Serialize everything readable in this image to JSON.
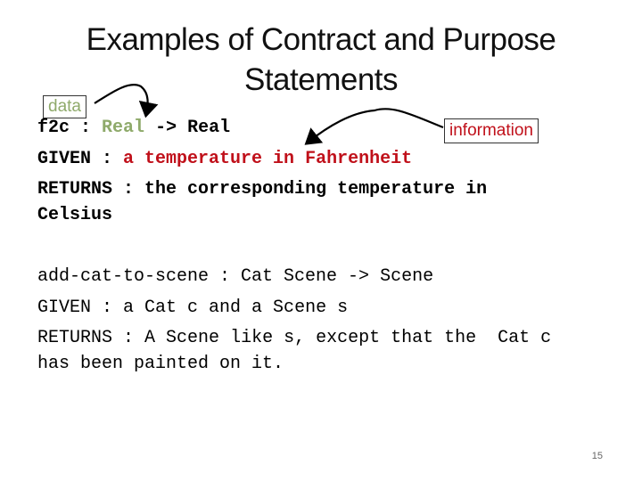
{
  "slide": {
    "title_line1": "Examples of Contract and Purpose",
    "title_line2": "Statements",
    "page_number": "15"
  },
  "annotations": {
    "data_label": "data",
    "information_label": "information",
    "data_color": "#8faa6b",
    "information_color": "#c0101a"
  },
  "example1": {
    "contract_name": "f2c :",
    "contract_arg": "Real",
    "contract_rest": "-> Real",
    "given_label": "GIVEN :",
    "given_text": "a temperature in Fahrenheit",
    "returns_label": "RETURNS :",
    "returns_text": "the corresponding temperature in",
    "returns_text_cont": "Celsius"
  },
  "example2": {
    "contract": "add-cat-to-scene : Cat Scene -> Scene",
    "given_label": "GIVEN :",
    "given_text": "a Cat c and a Scene s",
    "returns_label": "RETURNS :",
    "returns_text": "A Scene like s, except that the  Cat c",
    "returns_text_cont": "has been painted on it."
  }
}
